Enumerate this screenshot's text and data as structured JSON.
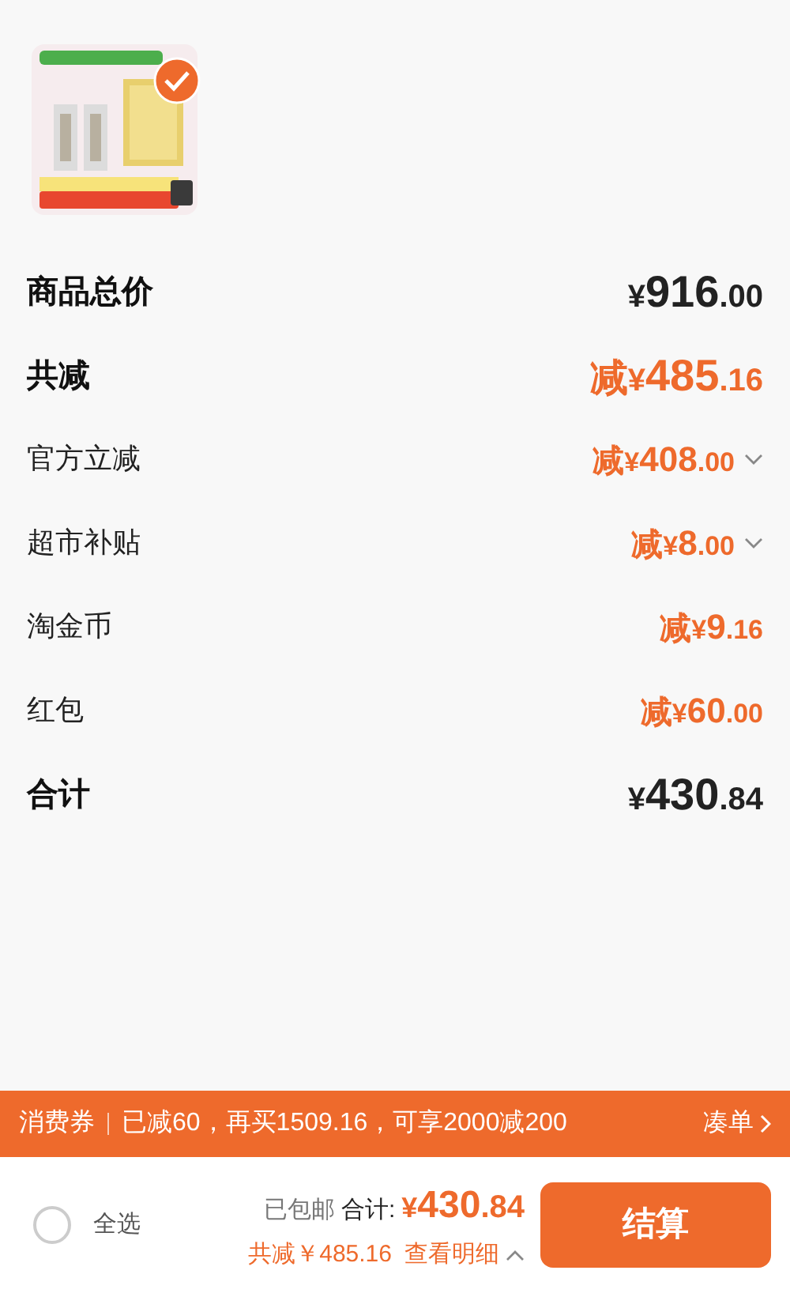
{
  "product": {
    "kind": "picture",
    "checked": true
  },
  "rows": [
    {
      "label": "商品总价",
      "kind": "header",
      "color": "#222222",
      "prefix": "",
      "currency": "¥",
      "integer": "916",
      "decimal": ".00",
      "expandable": false
    },
    {
      "label": "共减",
      "kind": "header",
      "color": "#ee6a2c",
      "prefix": "减",
      "currency": "¥",
      "integer": "485",
      "decimal": ".16",
      "expandable": false
    },
    {
      "label": "官方立减",
      "kind": "item",
      "color": "#ee6a2c",
      "prefix": "减",
      "currency": "¥",
      "integer": "408",
      "decimal": ".00",
      "expandable": true
    },
    {
      "label": "超市补贴",
      "kind": "item",
      "color": "#ee6a2c",
      "prefix": "减",
      "currency": "¥",
      "integer": "8",
      "decimal": ".00",
      "expandable": true
    },
    {
      "label": "淘金币",
      "kind": "item",
      "color": "#ee6a2c",
      "prefix": "减",
      "currency": "¥",
      "integer": "9",
      "decimal": ".16",
      "expandable": false
    },
    {
      "label": "红包",
      "kind": "item",
      "color": "#ee6a2c",
      "prefix": "减",
      "currency": "¥",
      "integer": "60",
      "decimal": ".00",
      "expandable": false
    },
    {
      "label": "合计",
      "kind": "header",
      "color": "#222222",
      "prefix": "",
      "currency": "¥",
      "integer": "430",
      "decimal": ".84",
      "expandable": false
    }
  ],
  "coupon_bar": {
    "label": "消费券",
    "message": "已减60，再买1509.16，可享2000减200",
    "action": "凑单"
  },
  "footer": {
    "select_all": {
      "label": "全选",
      "checked": false
    },
    "shipping": "已包邮",
    "total_label": "合计:",
    "currency": "¥",
    "total_integer": "430",
    "total_decimal": ".84",
    "saved": "共减￥485.16",
    "details": "查看明细",
    "checkout": "结算"
  }
}
